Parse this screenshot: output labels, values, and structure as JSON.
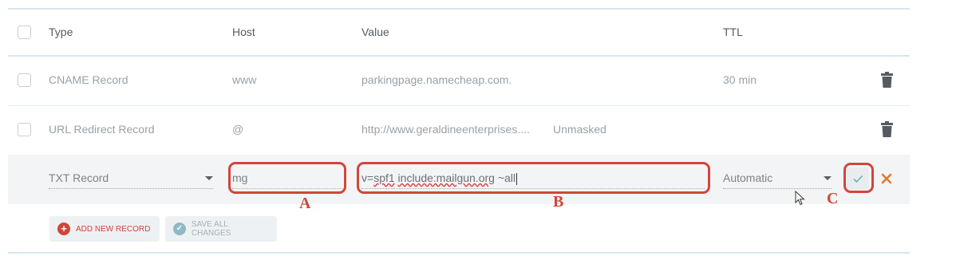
{
  "table": {
    "headers": {
      "type": "Type",
      "host": "Host",
      "value": "Value",
      "ttl": "TTL"
    },
    "rows": [
      {
        "type": "CNAME Record",
        "host": "www",
        "value": "parkingpage.namecheap.com.",
        "extra": "",
        "ttl": "30 min"
      },
      {
        "type": "URL Redirect Record",
        "host": "@",
        "value": "http://www.geraldineenterprises....",
        "extra": "Unmasked",
        "ttl": ""
      }
    ]
  },
  "edit_row": {
    "type": "TXT Record",
    "host": "mg",
    "value_parts": {
      "p1": "v=",
      "p2": "spf1",
      "p3": " ",
      "p4": "include:mailgun.org",
      "p5": " ~all"
    },
    "ttl": "Automatic"
  },
  "annotations": {
    "a": "A",
    "b": "B",
    "c": "C"
  },
  "actions": {
    "add_new_record": "ADD NEW RECORD",
    "save_all_changes": "SAVE ALL CHANGES"
  },
  "colors": {
    "accent_red": "#d0463b",
    "save_green": "#5db8a4",
    "row_edit_bg": "#f3f4f5"
  },
  "icons": [
    "checkbox",
    "trash-icon",
    "caret-down-icon",
    "check-icon",
    "close-icon",
    "plus-circle-icon",
    "check-circle-icon",
    "mouse-cursor-icon"
  ]
}
